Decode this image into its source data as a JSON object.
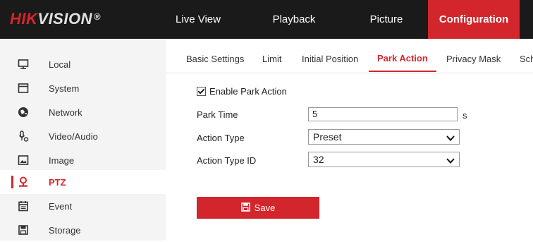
{
  "brand": {
    "logo_hik": "HIK",
    "logo_vision": "VISION",
    "logo_reg": "®"
  },
  "nav": {
    "live_view": "Live View",
    "playback": "Playback",
    "picture": "Picture",
    "configuration": "Configuration"
  },
  "sidebar": {
    "items": [
      {
        "label": "Local",
        "icon": "monitor-icon"
      },
      {
        "label": "System",
        "icon": "window-icon"
      },
      {
        "label": "Network",
        "icon": "globe-icon"
      },
      {
        "label": "Video/Audio",
        "icon": "microphone-icon"
      },
      {
        "label": "Image",
        "icon": "image-icon"
      },
      {
        "label": "PTZ",
        "icon": "ptz-camera-icon",
        "active": true
      },
      {
        "label": "Event",
        "icon": "calendar-icon"
      },
      {
        "label": "Storage",
        "icon": "floppy-disk-icon"
      }
    ]
  },
  "tabs": [
    {
      "label": "Basic Settings"
    },
    {
      "label": "Limit"
    },
    {
      "label": "Initial Position"
    },
    {
      "label": "Park Action",
      "active": true
    },
    {
      "label": "Privacy Mask"
    },
    {
      "label": "Sch"
    }
  ],
  "form": {
    "enable_label": "Enable Park Action",
    "enable_checked": true,
    "park_time_label": "Park Time",
    "park_time_value": "5",
    "park_time_unit": "s",
    "action_type_label": "Action Type",
    "action_type_value": "Preset",
    "action_type_id_label": "Action Type ID",
    "action_type_id_value": "32"
  },
  "save_button": {
    "label": "Save",
    "icon": "save-icon"
  },
  "colors": {
    "accent": "#d3252c",
    "topbar": "#1a1a1a",
    "sidebar": "#f4f4f4"
  }
}
